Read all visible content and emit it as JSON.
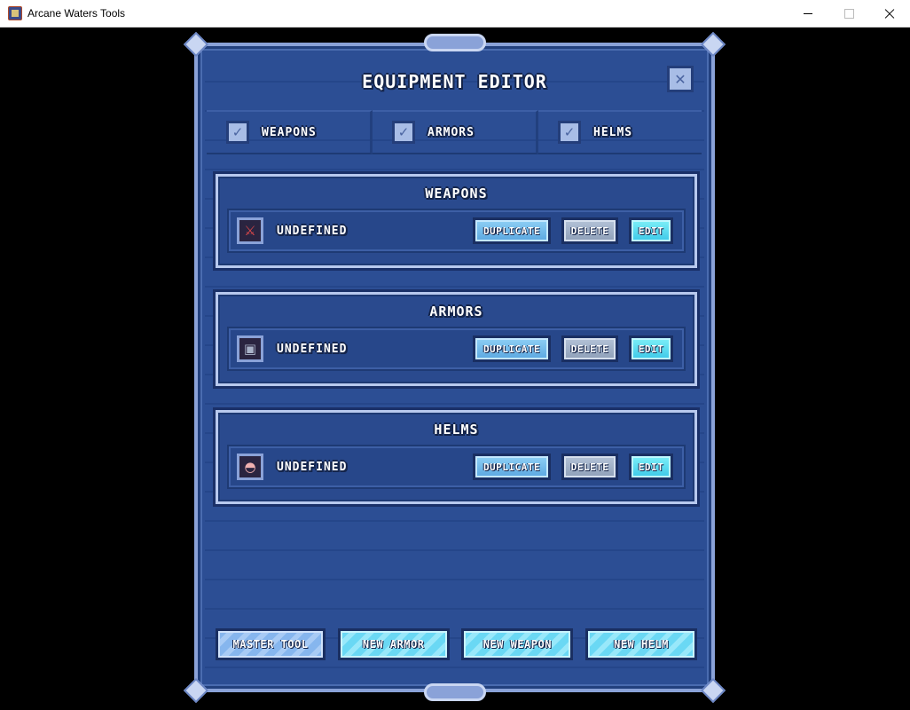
{
  "window": {
    "title": "Arcane Waters Tools"
  },
  "editor": {
    "title": "EQUIPMENT EDITOR",
    "close_icon": "close-icon",
    "filters": [
      {
        "label": "WEAPONS",
        "checked": true
      },
      {
        "label": "ARMORS",
        "checked": true
      },
      {
        "label": "HELMS",
        "checked": true
      }
    ],
    "sections": [
      {
        "title": "WEAPONS",
        "item": {
          "name": "UNDEFINED",
          "icon": "sword-icon"
        }
      },
      {
        "title": "ARMORS",
        "item": {
          "name": "UNDEFINED",
          "icon": "armor-icon"
        }
      },
      {
        "title": "HELMS",
        "item": {
          "name": "UNDEFINED",
          "icon": "helm-icon"
        }
      }
    ],
    "row_buttons": {
      "duplicate": "DUPLICATE",
      "delete": "DELETE",
      "edit": "EDIT"
    },
    "bottom_buttons": {
      "master_tool": "MASTER TOOL",
      "new_armor": "NEW ARMOR",
      "new_weapon": "NEW WEAPON",
      "new_helm": "NEW HELM"
    }
  }
}
